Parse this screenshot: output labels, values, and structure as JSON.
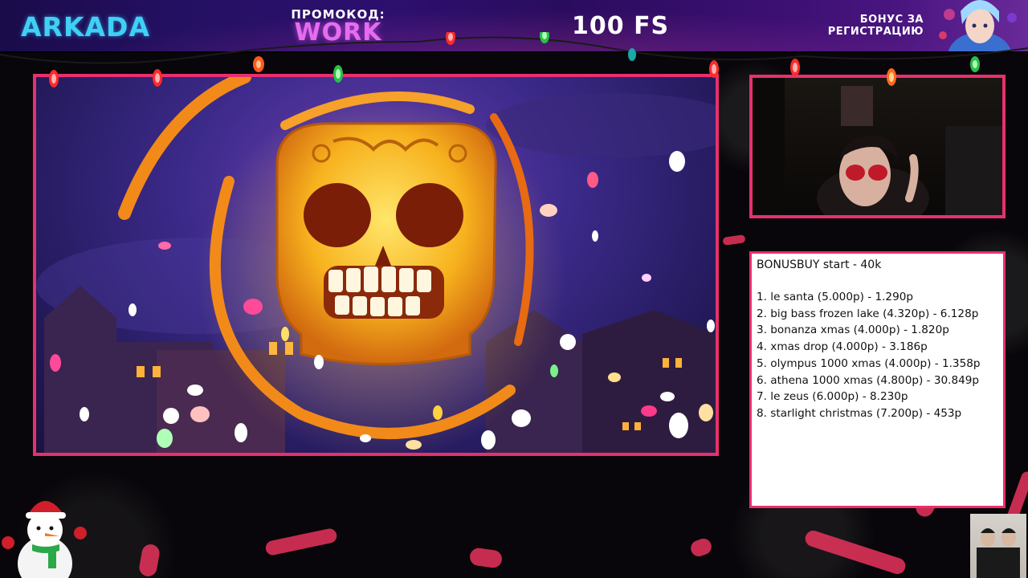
{
  "banner": {
    "logo": "ARKADA",
    "promo_label": "ПРОМОКОД:",
    "promo_code": "WORK",
    "free_spins": "100 FS",
    "bonus_line1": "БОНУС ЗА",
    "bonus_line2": "РЕГИСТРАЦИЮ"
  },
  "bonus_panel": {
    "title": "BONUSBUY start - 40k",
    "items": [
      "1. le santa (5.000р) - 1.290р",
      "2. big bass frozen lake (4.320р) - 6.128р",
      "3. bonanza xmas (4.000р) - 1.820р",
      "4. xmas drop (4.000р) - 3.186р",
      "5. olympus 1000 xmas (4.000р) - 1.358р",
      "6. athena 1000 xmas (4.800р) - 30.849р",
      "7. le zeus (6.000р) - 8.230р",
      "8. starlight christmas (7.200р) - 453р"
    ]
  },
  "colors": {
    "frame": "#e8306e",
    "logo": "#3fd0f5",
    "promo_code": "#e56cf0"
  }
}
